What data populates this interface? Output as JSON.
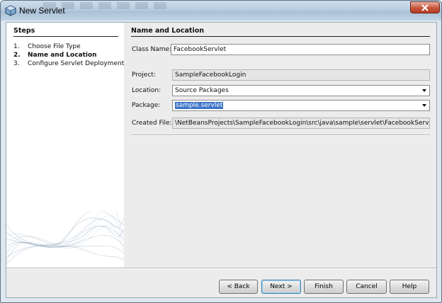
{
  "window": {
    "title": "New Servlet"
  },
  "steps": {
    "title": "Steps",
    "items": [
      {
        "num": "1.",
        "label": "Choose File Type"
      },
      {
        "num": "2.",
        "label": "Name and Location"
      },
      {
        "num": "3.",
        "label": "Configure Servlet Deployment"
      }
    ],
    "current_index": 1
  },
  "main": {
    "section_title": "Name and Location",
    "class_name_label": "Class Name:",
    "class_name_value": "FacebookServlet",
    "project_label": "Project:",
    "project_value": "SampleFacebookLogin",
    "location_label": "Location:",
    "location_value": "Source Packages",
    "package_label": "Package:",
    "package_value": "sample.servlet",
    "created_file_label": "Created File:",
    "created_file_value": "\\NetBeansProjects\\SampleFacebookLogin\\src\\java\\sample\\servlet\\FacebookServlet.java"
  },
  "buttons": {
    "back": "< Back",
    "next": "Next >",
    "finish": "Finish",
    "cancel": "Cancel",
    "help": "Help"
  },
  "colors": {
    "selection": "#3b73c7",
    "close_button": "#c8553d",
    "titlebar": "#b9cde0"
  }
}
